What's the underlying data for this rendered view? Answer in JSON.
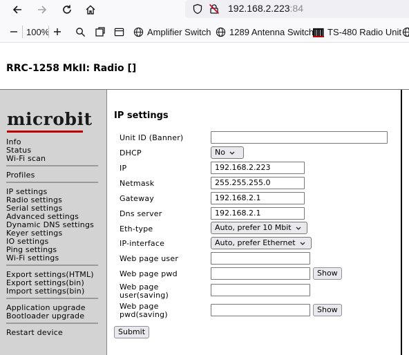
{
  "browser": {
    "url_host": "192.168.2.223",
    "url_port": ":84",
    "zoom": "100%",
    "bookmarks": [
      "Amplifier Switch",
      "1289 Antenna Switch",
      "TS-480 Radio Unit"
    ]
  },
  "page": {
    "title": "RRC-1258 MkII: Radio []"
  },
  "sidebar": {
    "logo": "microbit",
    "groups": [
      [
        "Info",
        "Status",
        "Wi-Fi scan"
      ],
      [
        "Profiles"
      ],
      [
        "IP settings",
        "Radio settings",
        "Serial settings",
        "Advanced settings",
        "Dynamic DNS settings",
        "Keyer settings",
        "IO settings",
        "Ping settings",
        "Wi-Fi settings"
      ],
      [
        "Export settings(HTML)",
        "Export settings(bin)",
        "Import settings(bin)"
      ],
      [
        "Application upgrade",
        "Bootloader upgrade"
      ],
      [
        "Restart device"
      ]
    ]
  },
  "form": {
    "title": "IP settings",
    "fields": {
      "unit_id": {
        "label": "Unit ID (Banner)",
        "value": ""
      },
      "dhcp": {
        "label": "DHCP",
        "value": "No"
      },
      "ip": {
        "label": "IP",
        "value": "192.168.2.223"
      },
      "netmask": {
        "label": "Netmask",
        "value": "255.255.255.0"
      },
      "gateway": {
        "label": "Gateway",
        "value": "192.168.2.1"
      },
      "dns": {
        "label": "Dns server",
        "value": "192.168.2.1"
      },
      "eth_type": {
        "label": "Eth-type",
        "value": "Auto, prefer 10 Mbit"
      },
      "ip_interface": {
        "label": "IP-interface",
        "value": "Auto, prefer Ethernet"
      },
      "web_user": {
        "label": "Web page user",
        "value": ""
      },
      "web_pwd": {
        "label": "Web page pwd",
        "value": ""
      },
      "web_user_saving": {
        "label_line1": "Web page",
        "label_line2": "user(saving)",
        "value": ""
      },
      "web_pwd_saving": {
        "label_line1": "Web page",
        "label_line2": "pwd(saving)",
        "value": ""
      }
    },
    "show_label": "Show",
    "submit_label": "Submit"
  }
}
